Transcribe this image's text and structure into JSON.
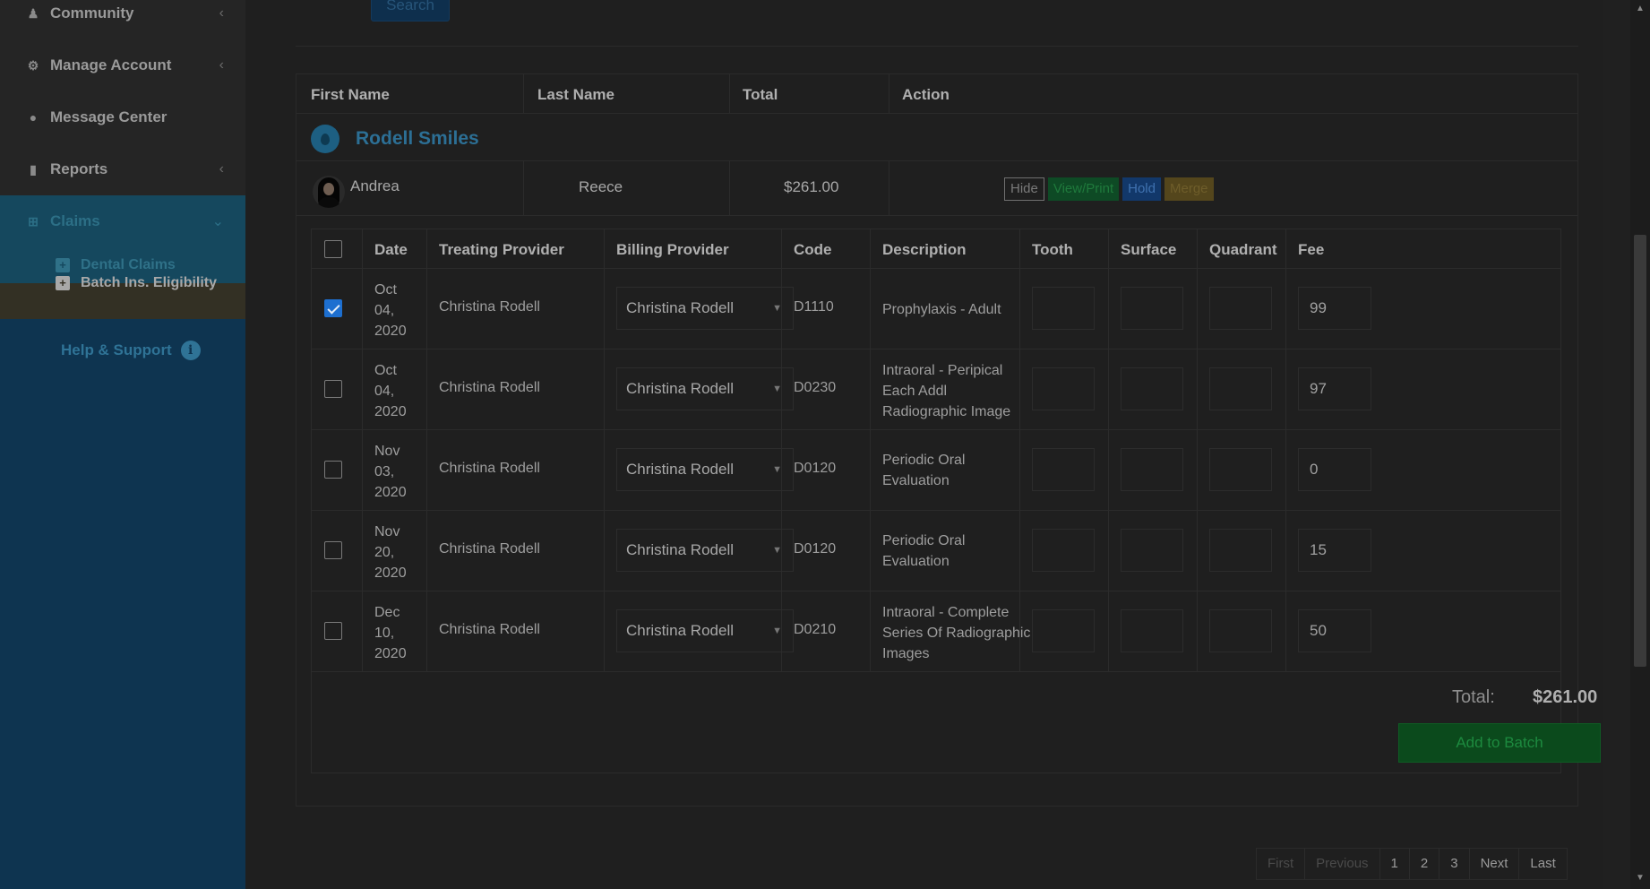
{
  "sidebar": {
    "items": [
      {
        "label": "Community",
        "icon": "community-icon"
      },
      {
        "label": "Manage Account",
        "icon": "gear-icon"
      },
      {
        "label": "Message Center",
        "icon": "chat-icon"
      },
      {
        "label": "Reports",
        "icon": "file-icon"
      },
      {
        "label": "Claims",
        "icon": "plus-square-icon"
      }
    ],
    "sub_items": [
      {
        "label": "Dental Claims"
      },
      {
        "label": "Batch Ins. Eligibility"
      }
    ],
    "help_label": "Help & Support",
    "chevron": "‹"
  },
  "search": {
    "label": "Search"
  },
  "table": {
    "headers": [
      "First Name",
      "Last Name",
      "Total",
      "Action"
    ],
    "practice": "Rodell Smiles",
    "patient": {
      "first": "Andrea",
      "last": "Reece",
      "total": "$261.00"
    },
    "actions": [
      "Hide",
      "View/Print",
      "Hold",
      "Merge"
    ]
  },
  "procedures": {
    "headers": [
      "Date",
      "Treating Provider",
      "Billing Provider",
      "Code",
      "Description",
      "Tooth",
      "Surface",
      "Quadrant",
      "Fee"
    ],
    "rows": [
      {
        "date": [
          "Oct",
          "04,",
          "2020"
        ],
        "treating": "Christina Rodell",
        "billing": "Christina Rodell",
        "code": "D1110",
        "desc": "Prophylaxis - Adult",
        "fee": "99",
        "checked": true
      },
      {
        "date": [
          "Oct",
          "04,",
          "2020"
        ],
        "treating": "Christina Rodell",
        "billing": "Christina Rodell",
        "code": "D0230",
        "desc": "Intraoral - Peripical Each Addl Radiographic Image",
        "fee": "97",
        "checked": false
      },
      {
        "date": [
          "Nov",
          "03,",
          "2020"
        ],
        "treating": "Christina Rodell",
        "billing": "Christina Rodell",
        "code": "D0120",
        "desc": "Periodic Oral Evaluation",
        "fee": "0",
        "checked": false
      },
      {
        "date": [
          "Nov",
          "20,",
          "2020"
        ],
        "treating": "Christina Rodell",
        "billing": "Christina Rodell",
        "code": "D0120",
        "desc": "Periodic Oral Evaluation",
        "fee": "15",
        "checked": false
      },
      {
        "date": [
          "Dec",
          "10,",
          "2020"
        ],
        "treating": "Christina Rodell",
        "billing": "Christina Rodell",
        "code": "D0210",
        "desc": "Intraoral - Complete Series Of Radiographic Images",
        "fee": "50",
        "checked": false
      }
    ],
    "total_label": "Total:",
    "total_value": "$261.00",
    "add_batch_label": "Add to Batch"
  },
  "pagination": [
    "First",
    "Previous",
    "1",
    "2",
    "3",
    "Next",
    "Last"
  ],
  "colors": {
    "sidebar_bg": "#0e3450",
    "accent_blue": "#2c6f95",
    "green_btn": "#0b4a1c",
    "overlay_dim": "#1f1f1f"
  }
}
